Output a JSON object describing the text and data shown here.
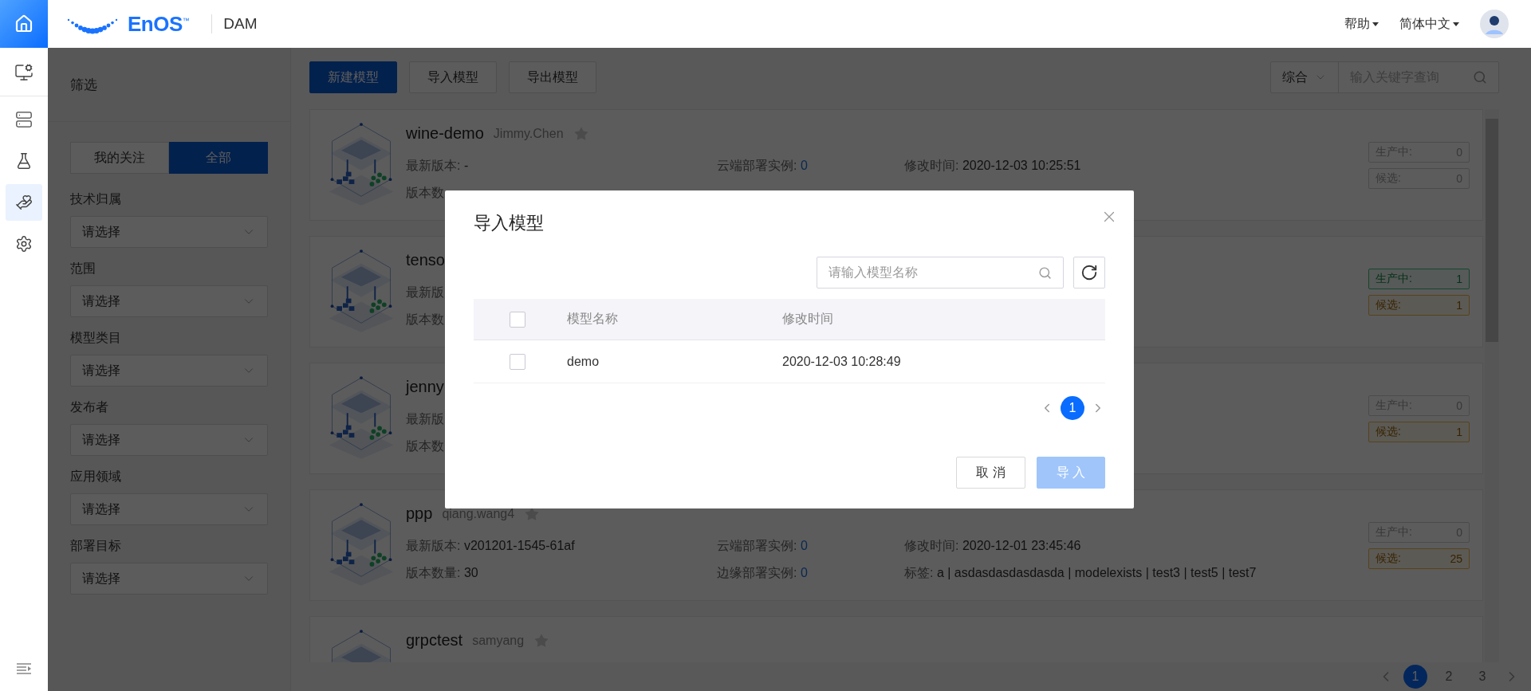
{
  "topbar": {
    "logo_text": "EnOS$^{™}$",
    "app_name": "DAM",
    "menus": [
      {
        "label": "帮助"
      },
      {
        "label": "简体中文"
      }
    ]
  },
  "rail": {
    "items": [
      {
        "kind": "monitor",
        "selected": false
      },
      {
        "kind": "server",
        "selected": false
      },
      {
        "kind": "flask",
        "selected": false
      },
      {
        "kind": "hand",
        "selected": true
      },
      {
        "kind": "target",
        "selected": false
      }
    ]
  },
  "filter": {
    "title": "筛选",
    "toggle": [
      {
        "label": "我的关注",
        "selected": false
      },
      {
        "label": "全部",
        "selected": true
      }
    ],
    "fields": [
      {
        "label": "技术归属",
        "placeholder": "请选择"
      },
      {
        "label": "范围",
        "placeholder": "请选择"
      },
      {
        "label": "模型类目",
        "placeholder": "请选择"
      },
      {
        "label": "发布者",
        "placeholder": "请选择"
      },
      {
        "label": "应用领域",
        "placeholder": "请选择"
      },
      {
        "label": "部署目标",
        "placeholder": "请选择"
      }
    ]
  },
  "toolbar": {
    "buttons": [
      {
        "label": "新建模型",
        "kind": "primary"
      },
      {
        "label": "导入模型",
        "kind": "default"
      },
      {
        "label": "导出模型",
        "kind": "default"
      }
    ],
    "sort": "综合",
    "search_placeholder": "输入关键字查询"
  },
  "models": [
    {
      "name": "wine-demo",
      "author": "Jimmy.Chen",
      "starred": false,
      "rows": [
        [
          {
            "label": "最新版本:",
            "value": "-",
            "kind": "text"
          },
          {
            "label": "云端部署实例:",
            "value": "0",
            "kind": "count"
          },
          {
            "label": "修改时间:",
            "value": "2020-12-03 10:25:51",
            "kind": "text"
          }
        ],
        [
          {
            "label": "版本数"
          }
        ]
      ],
      "status": [
        {
          "label": "生产中:",
          "value": "0",
          "kind": "production",
          "highlighted": false
        },
        {
          "label": "候选:",
          "value": "0",
          "kind": "candidate",
          "highlighted": false
        }
      ]
    },
    {
      "name": "tenso",
      "rows": [
        [
          {
            "label": "最新版"
          }
        ],
        [
          {
            "label": "版本数"
          }
        ]
      ],
      "status": [
        {
          "label": "生产中:",
          "value": "1",
          "kind": "production",
          "highlighted": true
        },
        {
          "label": "候选:",
          "value": "1",
          "kind": "candidate",
          "highlighted": true
        }
      ]
    },
    {
      "name": "jenny",
      "rows": [
        [
          {
            "label": "最新版"
          }
        ],
        [
          {
            "label": "版本数"
          }
        ]
      ],
      "status": [
        {
          "label": "生产中:",
          "value": "0",
          "kind": "production",
          "highlighted": false
        },
        {
          "label": "候选:",
          "value": "1",
          "kind": "candidate",
          "highlighted": true
        }
      ]
    },
    {
      "name": "ppp",
      "author": "qiang.wang4",
      "starred": false,
      "rows": [
        [
          {
            "label": "最新版本:",
            "value": "v201201-1545-61af",
            "kind": "text"
          },
          {
            "label": "云端部署实例:",
            "value": "0",
            "kind": "count"
          },
          {
            "label": "修改时间:",
            "value": "2020-12-01 23:45:46",
            "kind": "text"
          }
        ],
        [
          {
            "label": "版本数量:",
            "value": "30",
            "kind": "text"
          },
          {
            "label": "边缘部署实例:",
            "value": "0",
            "kind": "count"
          },
          {
            "label": "标签:",
            "value": "a | asdasdasdasdasda | modelexists | test3 | test5 | test7",
            "kind": "text"
          }
        ]
      ],
      "status": [
        {
          "label": "生产中:",
          "value": "0",
          "kind": "production",
          "highlighted": false
        },
        {
          "label": "候选:",
          "value": "25",
          "kind": "candidate",
          "highlighted": true
        }
      ]
    },
    {
      "name": "grpctest",
      "author": "samyang",
      "starred": false
    }
  ],
  "pagination": {
    "pages": [
      {
        "label": "1",
        "selected": true
      },
      {
        "label": "2",
        "selected": false
      },
      {
        "label": "3",
        "selected": false
      }
    ]
  },
  "dialog": {
    "title": "导入模型",
    "search_placeholder": "请输入模型名称",
    "header_checked": false,
    "columns": [
      "模型名称",
      "修改时间"
    ],
    "rows": [
      {
        "checked": false,
        "cells": [
          "demo",
          "2020-12-03 10:28:49"
        ]
      }
    ],
    "pages": [
      {
        "label": "1",
        "selected": true
      }
    ],
    "buttons": [
      {
        "label": "取 消",
        "kind": "default",
        "disabled": false
      },
      {
        "label": "导 入",
        "kind": "primary",
        "disabled": true
      }
    ]
  }
}
